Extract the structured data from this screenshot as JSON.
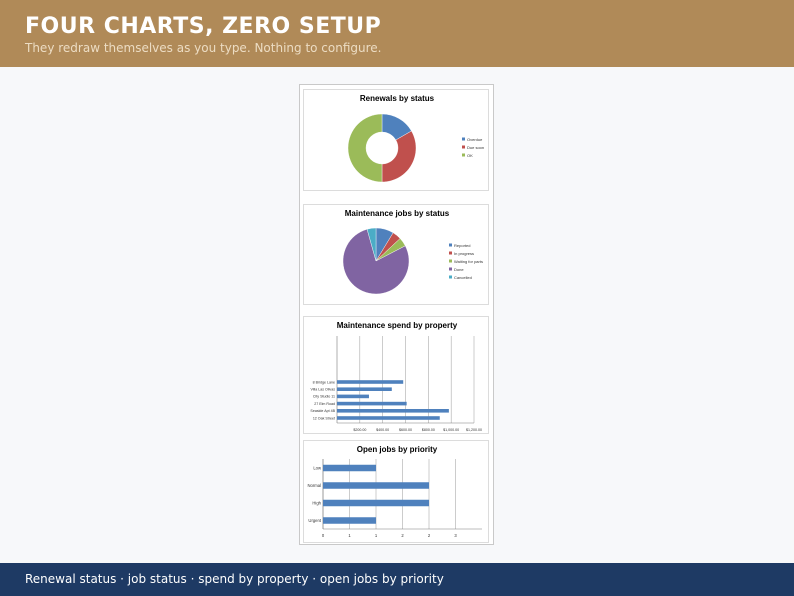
{
  "header": {
    "title": "FOUR CHARTS, ZERO SETUP",
    "subtitle": "They redraw themselves as you type. Nothing to configure."
  },
  "footer": {
    "text": "Renewal status  ·  job status  ·  spend by property  ·  open jobs by priority"
  },
  "chart_data": [
    {
      "type": "pie",
      "variant": "donut",
      "title": "Renewals by status",
      "categories": [
        "Overdue",
        "Due soon",
        "OK"
      ],
      "values": [
        1,
        2,
        3
      ],
      "colors": [
        "#4f81bd",
        "#c0504d",
        "#9bbb59"
      ],
      "legend": "right"
    },
    {
      "type": "pie",
      "title": "Maintenance jobs by status",
      "categories": [
        "Reported",
        "In progress",
        "Waiting for parts",
        "Done",
        "Cancelled"
      ],
      "values": [
        2,
        1,
        1,
        18,
        1
      ],
      "colors": [
        "#4f81bd",
        "#c0504d",
        "#9bbb59",
        "#8064a2",
        "#4bacc6"
      ],
      "legend": "right"
    },
    {
      "type": "bar",
      "orientation": "horizontal",
      "title": "Maintenance spend by property",
      "categories": [
        "8 Bridge Lane",
        "Villa Las Olivas",
        "City Studio 11",
        "27 Elm Road",
        "Seaside Apt 4B",
        "12 Oak Street"
      ],
      "values": [
        580,
        480,
        280,
        610,
        980,
        900
      ],
      "xlim": [
        0,
        1200
      ],
      "ticks": [
        "$200.00",
        "$400.00",
        "$600.00",
        "$800.00",
        "$1,000.00",
        "$1,200.00"
      ],
      "tick_values": [
        200,
        400,
        600,
        800,
        1000,
        1200
      ],
      "grid": true,
      "color": "#4f81bd"
    },
    {
      "type": "bar",
      "orientation": "horizontal",
      "title": "Open jobs by priority",
      "categories": [
        "Low",
        "Normal",
        "High",
        "Urgent"
      ],
      "values": [
        1,
        2,
        2,
        1
      ],
      "xlim": [
        0,
        3
      ],
      "ticks": [
        "0",
        "1",
        "1",
        "2",
        "2",
        "3"
      ],
      "tick_values": [
        0,
        0.5,
        1,
        1.5,
        2,
        2.5
      ],
      "grid": true,
      "color": "#4f81bd"
    }
  ]
}
